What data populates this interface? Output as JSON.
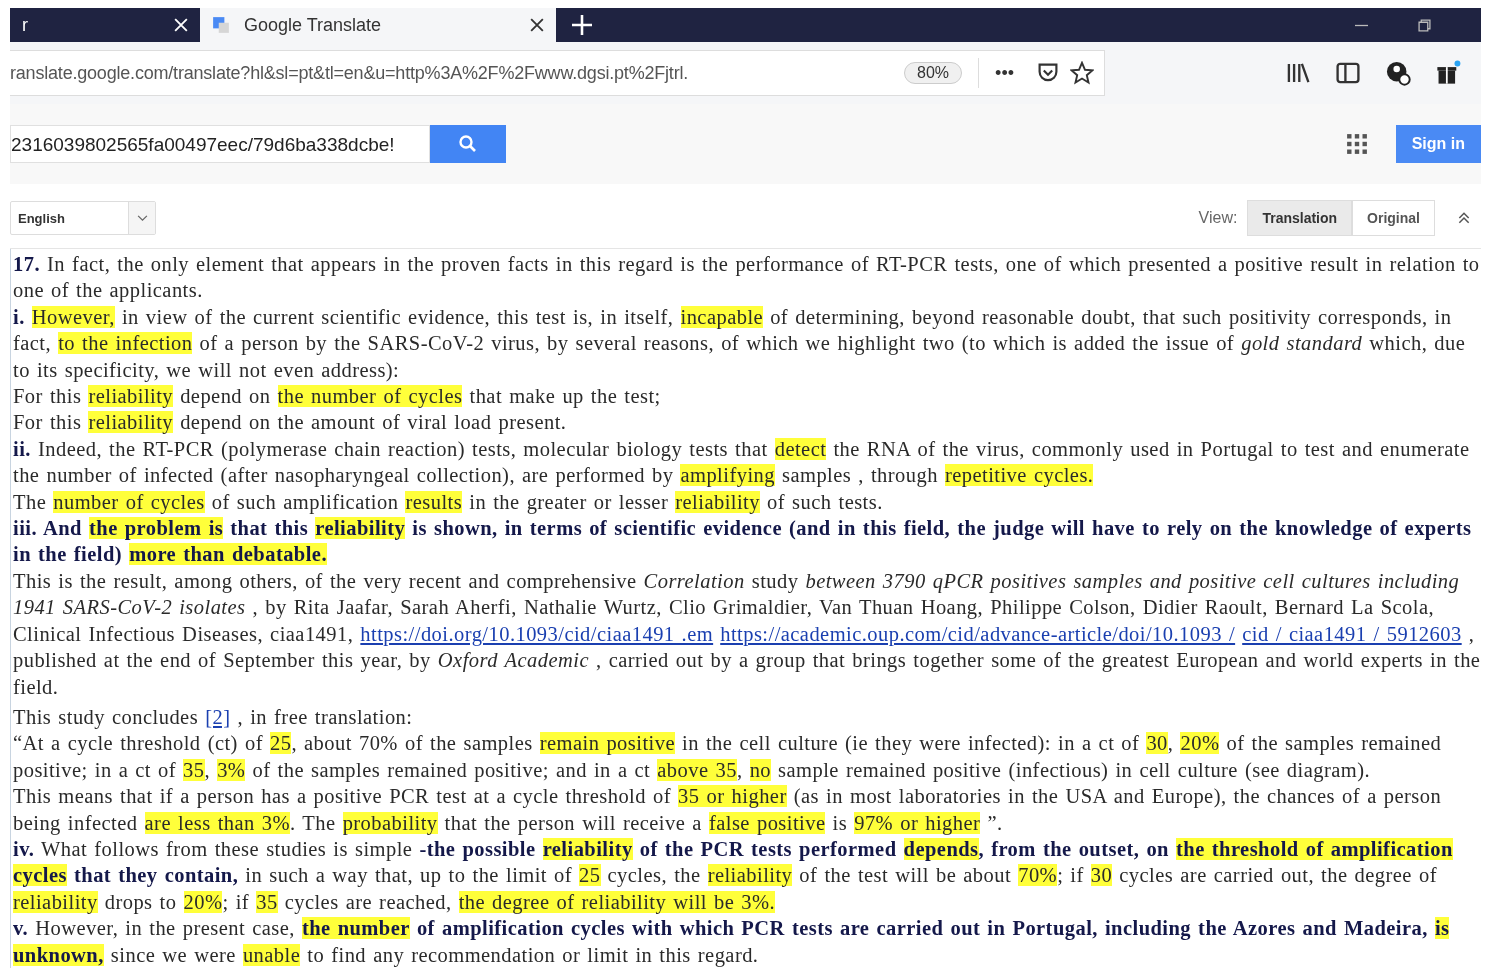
{
  "tabs": [
    {
      "title": "r",
      "selected": false
    },
    {
      "title": "Google Translate",
      "selected": true
    }
  ],
  "address_bar": {
    "url": "ranslate.google.com/translate?hl&sl=pt&tl=en&u=http%3A%2F%2Fwww.dgsi.pt%2Fjtrl.",
    "zoom": "80%",
    "more": "•••"
  },
  "search": {
    "value": "2316039802565fa00497eec/79d6ba338dcbe!"
  },
  "sign_in": "Sign in",
  "language": "English",
  "view": {
    "label": "View:",
    "options": [
      {
        "label": "Translation",
        "selected": true
      },
      {
        "label": "Original",
        "selected": false
      }
    ]
  },
  "paragraphs": [
    [
      {
        "kind": "text",
        "text": "**17.** In fact, the only element that appears in the proven facts in this regard is the performance of RT-PCR tests, one of which presented a positive result in relation to one of the applicants.",
        "highlight": false
      }
    ],
    [
      {
        "kind": "text",
        "text": "**i.** ",
        "highlight": false
      },
      {
        "kind": "text",
        "text": "However,",
        "highlight": true
      },
      {
        "kind": "text",
        "text": " in view of the current scientific evidence, this test is, in itself, ",
        "highlight": false
      },
      {
        "kind": "text",
        "text": "incapable",
        "highlight": true
      },
      {
        "kind": "text",
        "text": " of determining, beyond reasonable doubt, that such positivity corresponds, in fact, ",
        "highlight": false
      },
      {
        "kind": "text",
        "text": "to the infection",
        "highlight": true
      },
      {
        "kind": "text",
        "text": " of a person by the SARS-CoV-2 virus, by several reasons, of which we highlight two (to which is added the issue of *gold standard* which, due to its specificity, we will not even address):",
        "highlight": false
      }
    ],
    [
      {
        "kind": "text",
        "text": "For this ",
        "highlight": false
      },
      {
        "kind": "text",
        "text": "reliability",
        "highlight": true
      },
      {
        "kind": "text",
        "text": " depend on ",
        "highlight": false
      },
      {
        "kind": "text",
        "text": "the number of cycles",
        "highlight": true
      },
      {
        "kind": "text",
        "text": " that make up the test;",
        "highlight": false
      }
    ],
    [
      {
        "kind": "text",
        "text": "For this ",
        "highlight": false
      },
      {
        "kind": "text",
        "text": "reliability",
        "highlight": true
      },
      {
        "kind": "text",
        "text": " depend on the amount of viral load present.",
        "highlight": false
      }
    ],
    [
      {
        "kind": "text",
        "text": "**ii.** Indeed, the RT-PCR (polymerase chain reaction) tests, molecular biology tests that ",
        "highlight": false
      },
      {
        "kind": "text",
        "text": "detect",
        "highlight": true
      },
      {
        "kind": "text",
        "text": " the RNA of the virus, commonly used in Portugal to test and enumerate the number of infected (after nasopharyngeal collection), are performed by ",
        "highlight": false
      },
      {
        "kind": "text",
        "text": "amplifying",
        "highlight": true
      },
      {
        "kind": "text",
        "text": " samples , through ",
        "highlight": false
      },
      {
        "kind": "text",
        "text": "repetitive cycles.",
        "highlight": true
      }
    ],
    [
      {
        "kind": "text",
        "text": "The ",
        "highlight": false
      },
      {
        "kind": "text",
        "text": "number of cycles",
        "highlight": true
      },
      {
        "kind": "text",
        "text": " of such amplification ",
        "highlight": false
      },
      {
        "kind": "text",
        "text": "results",
        "highlight": true
      },
      {
        "kind": "text",
        "text": " in the greater or lesser ",
        "highlight": false
      },
      {
        "kind": "text",
        "text": "reliability",
        "highlight": true
      },
      {
        "kind": "text",
        "text": " of such tests.",
        "highlight": false
      }
    ],
    [
      {
        "kind": "text",
        "text": "**iii. And** ",
        "highlight": false
      },
      {
        "kind": "text",
        "text": "**the problem is**",
        "highlight": true
      },
      {
        "kind": "text",
        "text": " **that this** ",
        "highlight": false
      },
      {
        "kind": "text",
        "text": "**reliability**",
        "highlight": true
      },
      {
        "kind": "text",
        "text": " **is shown, in terms of scientific evidence (and in this field, the judge will have to rely on the knowledge of experts in the field)** ",
        "highlight": false
      },
      {
        "kind": "text",
        "text": "**more than debatable.**",
        "highlight": true
      }
    ],
    [
      {
        "kind": "text",
        "text": "This is the result, among others, of the very recent and comprehensive *Correlation* study *between 3790 qPCR positives samples and positive cell cultures including 1941 SARS-CoV-2 isolates* , by Rita Jaafar, Sarah Aherfi, Nathalie Wurtz, Clio Grimaldier, Van Thuan Hoang, Philippe Colson, Didier Raoult, Bernard La Scola, Clinical Infectious Diseases, ciaa1491, ",
        "highlight": false
      },
      {
        "kind": "link",
        "text": "https://doi.org/10.1093/cid/ciaa1491 .em",
        "highlight": false
      },
      {
        "kind": "link",
        "text": "https://academic.oup.com/cid/advance-article/doi/10.1093 /",
        "highlight": false
      },
      {
        "kind": "link",
        "text": "cid / ciaa1491 / 5912603",
        "highlight": false
      },
      {
        "kind": "text",
        "text": " , published at the end of September this year, by *Oxford Academic* , carried out by a group that brings together some of the greatest European and world experts in the field.",
        "highlight": false
      }
    ],
    [
      {
        "kind": "text",
        "text": "This study concludes ",
        "highlight": false
      },
      {
        "kind": "link",
        "text": "[2]",
        "highlight": false
      },
      {
        "kind": "text",
        "text": " , in free translation:",
        "highlight": false
      }
    ],
    [
      {
        "kind": "text",
        "text": "“At a cycle threshold (ct) of ",
        "highlight": false
      },
      {
        "kind": "text",
        "text": "25",
        "highlight": true
      },
      {
        "kind": "text",
        "text": ", about 70% of the samples ",
        "highlight": false
      },
      {
        "kind": "text",
        "text": "remain positive",
        "highlight": true
      },
      {
        "kind": "text",
        "text": " in the cell culture (ie they were infected): in a ct of ",
        "highlight": false
      },
      {
        "kind": "text",
        "text": "30",
        "highlight": true
      },
      {
        "kind": "text",
        "text": ", ",
        "highlight": false
      },
      {
        "kind": "text",
        "text": "20%",
        "highlight": true
      },
      {
        "kind": "text",
        "text": " of the samples remained positive; in a ct of ",
        "highlight": false
      },
      {
        "kind": "text",
        "text": "35",
        "highlight": true
      },
      {
        "kind": "text",
        "text": ", ",
        "highlight": false
      },
      {
        "kind": "text",
        "text": "3%",
        "highlight": true
      },
      {
        "kind": "text",
        "text": " of the samples remained positive; and in a ct ",
        "highlight": false
      },
      {
        "kind": "text",
        "text": "above 35",
        "highlight": true
      },
      {
        "kind": "text",
        "text": ", ",
        "highlight": false
      },
      {
        "kind": "text",
        "text": "no",
        "highlight": true
      },
      {
        "kind": "text",
        "text": " sample remained positive (infectious) in cell culture (see diagram).",
        "highlight": false
      }
    ],
    [
      {
        "kind": "text",
        "text": "This means that if a person has a positive PCR test at a cycle threshold of ",
        "highlight": false
      },
      {
        "kind": "text",
        "text": "35 or higher",
        "highlight": true
      },
      {
        "kind": "text",
        "text": " (as in most laboratories in the USA and Europe), the chances of a person being infected ",
        "highlight": false
      },
      {
        "kind": "text",
        "text": "are less than 3%",
        "highlight": true
      },
      {
        "kind": "text",
        "text": ". The ",
        "highlight": false
      },
      {
        "kind": "text",
        "text": "probability",
        "highlight": true
      },
      {
        "kind": "text",
        "text": " that the person will receive a ",
        "highlight": false
      },
      {
        "kind": "text",
        "text": "false positive",
        "highlight": true
      },
      {
        "kind": "text",
        "text": " is ",
        "highlight": false
      },
      {
        "kind": "text",
        "text": "97% or higher",
        "highlight": true
      },
      {
        "kind": "text",
        "text": " ”.",
        "highlight": false
      }
    ],
    [
      {
        "kind": "text",
        "text": "**iv.** What follows from these studies is simple **-the possible** ",
        "highlight": false
      },
      {
        "kind": "text",
        "text": "**reliability**",
        "highlight": true
      },
      {
        "kind": "text",
        "text": " **of the PCR tests performed** ",
        "highlight": false
      },
      {
        "kind": "text",
        "text": "**depends**",
        "highlight": true
      },
      {
        "kind": "text",
        "text": "**, from the outset, on** ",
        "highlight": false
      },
      {
        "kind": "text",
        "text": "**the threshold of amplification cycles**",
        "highlight": true
      },
      {
        "kind": "text",
        "text": " **that they contain,** in such a way that, up to the limit of ",
        "highlight": false
      },
      {
        "kind": "text",
        "text": "25",
        "highlight": true
      },
      {
        "kind": "text",
        "text": " cycles, the ",
        "highlight": false
      },
      {
        "kind": "text",
        "text": "reliability",
        "highlight": true
      },
      {
        "kind": "text",
        "text": " of the test will be about ",
        "highlight": false
      },
      {
        "kind": "text",
        "text": "70%",
        "highlight": true
      },
      {
        "kind": "text",
        "text": "; if ",
        "highlight": false
      },
      {
        "kind": "text",
        "text": "30",
        "highlight": true
      },
      {
        "kind": "text",
        "text": " cycles are carried out, the degree of ",
        "highlight": false
      },
      {
        "kind": "text",
        "text": "reliability",
        "highlight": true
      },
      {
        "kind": "text",
        "text": " drops to ",
        "highlight": false
      },
      {
        "kind": "text",
        "text": "20%",
        "highlight": true
      },
      {
        "kind": "text",
        "text": "; if ",
        "highlight": false
      },
      {
        "kind": "text",
        "text": "35",
        "highlight": true
      },
      {
        "kind": "text",
        "text": " cycles are reached, ",
        "highlight": false
      },
      {
        "kind": "text",
        "text": "the degree of reliability will be 3%.",
        "highlight": true
      }
    ],
    [
      {
        "kind": "text",
        "text": "**v.** However, in the present case, ",
        "highlight": false
      },
      {
        "kind": "text",
        "text": "**the number**",
        "highlight": true
      },
      {
        "kind": "text",
        "text": " **of amplification cycles with which PCR tests are carried out in Portugal, including the Azores and Madeira,** ",
        "highlight": false
      },
      {
        "kind": "text",
        "text": "**is unknown,**",
        "highlight": true
      },
      {
        "kind": "text",
        "text": " since we were ",
        "highlight": false
      },
      {
        "kind": "text",
        "text": "unable",
        "highlight": true
      },
      {
        "kind": "text",
        "text": " to find any recommendation or limit in this regard.",
        "highlight": false
      }
    ]
  ]
}
